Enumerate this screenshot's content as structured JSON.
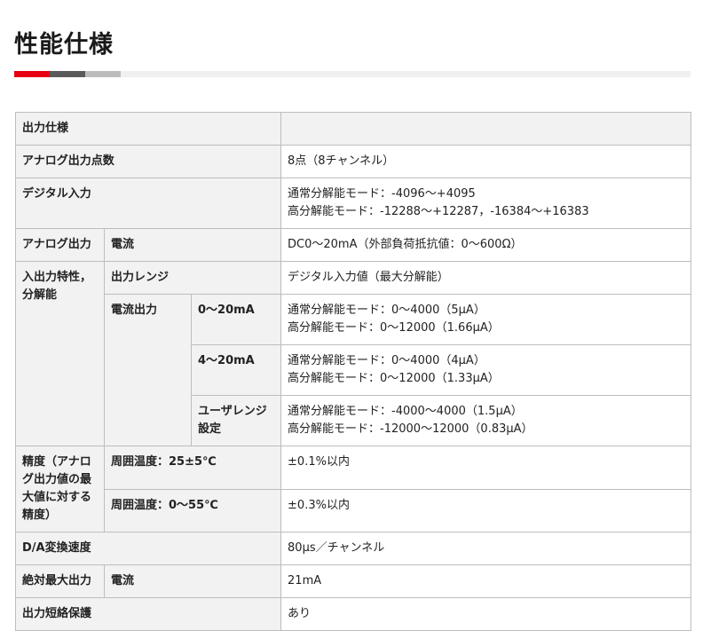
{
  "page": {
    "title": "性能仕様"
  },
  "table": {
    "section": "出力仕様",
    "r1": {
      "label": "アナログ出力点数",
      "value": "8点（8チャンネル）"
    },
    "r2": {
      "label": "デジタル入力",
      "line1": "通常分解能モード：-4096～+4095",
      "line2": "高分解能モード：-12288～+12287，-16384～+16383"
    },
    "r3": {
      "label": "アナログ出力",
      "sub": "電流",
      "value": "DC0～20mA（外部負荷抵抗値：0～600Ω）"
    },
    "r4": {
      "label": "入出力特性，分解能",
      "sub": "出力レンジ",
      "value": "デジタル入力値（最大分解能）"
    },
    "r5": {
      "sub": "電流出力",
      "range": "0～20mA",
      "line1": "通常分解能モード：0～4000（5μA）",
      "line2": "高分解能モード：0～12000（1.66μA）"
    },
    "r6": {
      "range": "4～20mA",
      "line1": "通常分解能モード：0～4000（4μA）",
      "line2": "高分解能モード：0～12000（1.33μA）"
    },
    "r7": {
      "range": "ユーザレンジ設定",
      "line1": "通常分解能モード：-4000～4000（1.5μA）",
      "line2": "高分解能モード：-12000～12000（0.83μA）"
    },
    "r8": {
      "label": "精度（アナログ出力値の最大値に対する精度）",
      "sub": "周囲温度：25±5℃",
      "value": "±0.1%以内"
    },
    "r9": {
      "sub": "周囲温度：0～55℃",
      "value": "±0.3%以内"
    },
    "r10": {
      "label": "D/A変換速度",
      "value": "80μs／チャンネル"
    },
    "r11": {
      "label": "絶対最大出力",
      "sub": "電流",
      "value": "21mA"
    },
    "r12": {
      "label": "出力短絡保護",
      "value": "あり"
    }
  },
  "colors": {
    "accent": "#e60012",
    "header_bg": "#f2f2f2",
    "border": "#bdbdbd"
  }
}
